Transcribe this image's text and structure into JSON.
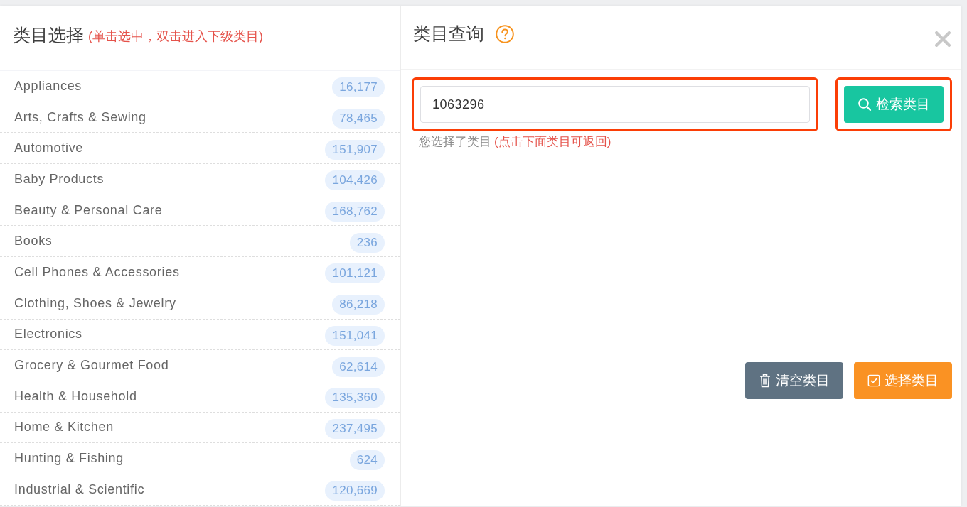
{
  "category_select": {
    "title": "类目选择",
    "hint": "(单击选中，双击进入下级类目)",
    "items": [
      {
        "name": "Appliances",
        "count": "16,177"
      },
      {
        "name": "Arts, Crafts & Sewing",
        "count": "78,465"
      },
      {
        "name": "Automotive",
        "count": "151,907"
      },
      {
        "name": "Baby Products",
        "count": "104,426"
      },
      {
        "name": "Beauty & Personal Care",
        "count": "168,762"
      },
      {
        "name": "Books",
        "count": "236"
      },
      {
        "name": "Cell Phones & Accessories",
        "count": "101,121"
      },
      {
        "name": "Clothing, Shoes & Jewelry",
        "count": "86,218"
      },
      {
        "name": "Electronics",
        "count": "151,041"
      },
      {
        "name": "Grocery & Gourmet Food",
        "count": "62,614"
      },
      {
        "name": "Health & Household",
        "count": "135,360"
      },
      {
        "name": "Home & Kitchen",
        "count": "237,495"
      },
      {
        "name": "Hunting & Fishing",
        "count": "624"
      },
      {
        "name": "Industrial & Scientific",
        "count": "120,669"
      }
    ]
  },
  "category_query": {
    "title": "类目查询",
    "search_field": {
      "value": "1063296",
      "highlighted": true
    },
    "search_button": {
      "label": "检索类目",
      "highlighted": true
    },
    "selection_label": "您选择了类目",
    "selection_hint": "(点击下面类目可返回)",
    "buttons": [
      {
        "kind": "clear",
        "label": "清空类目"
      },
      {
        "kind": "select",
        "label": "选择类目"
      }
    ]
  }
}
